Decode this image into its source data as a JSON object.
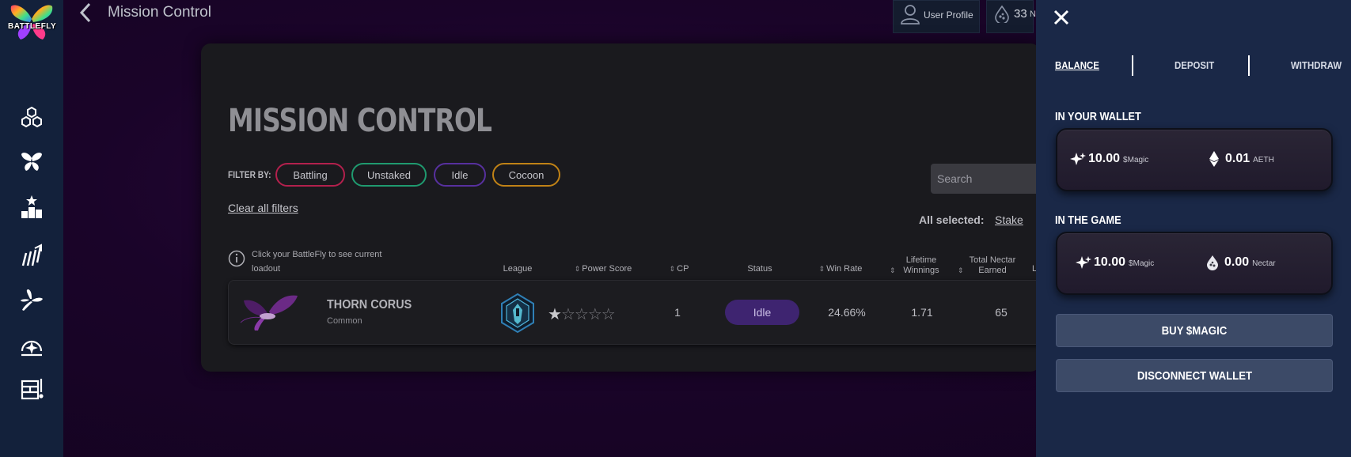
{
  "app": {
    "logo_text": "BATTLEFLY",
    "page_title": "Mission Control"
  },
  "topbar": {
    "profile_label": "User Profile",
    "nectar_count": "33",
    "nectar_label_partial": "N"
  },
  "sidebar": {
    "items": [
      {
        "icon": "hexagons-icon"
      },
      {
        "icon": "butterfly-icon"
      },
      {
        "icon": "leaderboard-icon"
      },
      {
        "icon": "growth-icon"
      },
      {
        "icon": "dragonfly-icon"
      },
      {
        "icon": "compass-icon"
      },
      {
        "icon": "inventory-icon"
      }
    ]
  },
  "main": {
    "title": "MISSION CONTROL",
    "filter_label": "FILTER BY:",
    "filters": [
      {
        "label": "Battling",
        "color": "#b3204d"
      },
      {
        "label": "Unstaked",
        "color": "#1f9a6f"
      },
      {
        "label": "Idle",
        "color": "#57309e"
      },
      {
        "label": "Cocoon",
        "color": "#c08216"
      }
    ],
    "clear_filters": "Clear all filters",
    "search_placeholder": "Search",
    "all_selected_label": "All selected:",
    "stake_link": "Stake",
    "hint": "Click your BattleFly to see current loadout",
    "columns": {
      "league": "League",
      "power_score": "Power Score",
      "cp": "CP",
      "status": "Status",
      "win_rate": "Win Rate",
      "lifetime_winnings": "Lifetime Winnings",
      "total_nectar_earned": "Total Nectar Earned",
      "partial": "L"
    },
    "rows": [
      {
        "name": "THORN CORUS",
        "rarity": "Common",
        "power_score_stars": 1,
        "power_score_max": 5,
        "cp": "1",
        "status": "Idle",
        "win_rate": "24.66%",
        "lifetime_winnings": "1.71",
        "total_nectar_earned": "65"
      }
    ]
  },
  "wallet": {
    "tabs": [
      "BALANCE",
      "DEPOSIT",
      "WITHDRAW"
    ],
    "active_tab": "BALANCE",
    "in_wallet": {
      "title": "IN YOUR WALLET",
      "magic_value": "10.00",
      "magic_unit": "$Magic",
      "eth_value": "0.01",
      "eth_unit": "AETH"
    },
    "in_game": {
      "title": "IN THE GAME",
      "magic_value": "10.00",
      "magic_unit": "$Magic",
      "nectar_value": "0.00",
      "nectar_unit": "Nectar"
    },
    "buy_button": "BUY $MAGIC",
    "disconnect_button": "DISCONNECT WALLET"
  }
}
